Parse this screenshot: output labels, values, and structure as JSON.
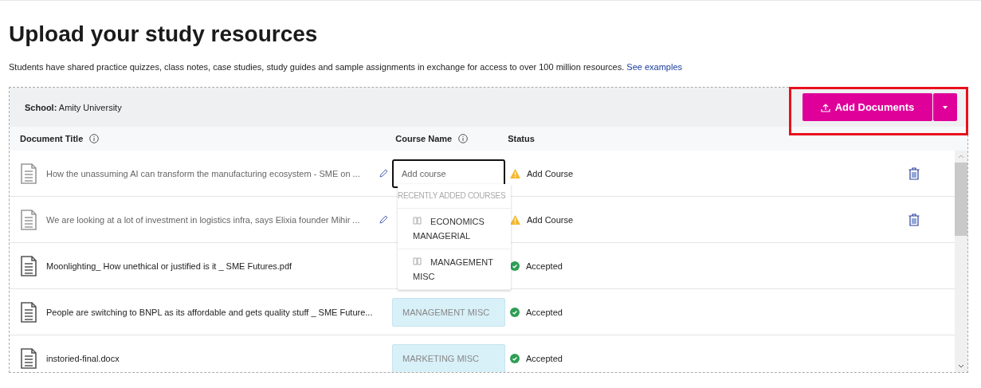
{
  "title": "Upload your study resources",
  "intro": {
    "text": "Students have shared practice quizzes, class notes, case studies, study guides and sample assignments in exchange for access to over 100 million resources.",
    "link": "See examples"
  },
  "school": {
    "label": "School:",
    "value": "Amity University"
  },
  "add_button": {
    "label": "Add Documents"
  },
  "columns": [
    "Document Title",
    "Course Name",
    "Status"
  ],
  "rows": [
    {
      "title": "How the unassuming AI can transform the manufacturing ecosystem - SME on ...",
      "pending": true,
      "course_field": {
        "placeholder": "Add course"
      },
      "status": {
        "kind": "warning",
        "label": "Add Course"
      }
    },
    {
      "title": "We are looking at a lot of investment in logistics infra, says Elixia founder Mihir ...",
      "pending": true,
      "status": {
        "kind": "warning",
        "label": "Add Course"
      }
    },
    {
      "title": "Moonlighting_ How unethical or justified is it _ SME Futures.pdf",
      "pending": false,
      "status": {
        "kind": "accepted",
        "label": "Accepted"
      }
    },
    {
      "title": "People are switching to BNPL as its affordable and gets quality stuff _ SME Future...",
      "pending": false,
      "course": "MANAGEMENT MISC",
      "status": {
        "kind": "accepted",
        "label": "Accepted"
      }
    },
    {
      "title": "instoried-final.docx",
      "pending": false,
      "course": "MARKETING MISC",
      "status": {
        "kind": "accepted",
        "label": "Accepted"
      }
    }
  ],
  "dropdown": {
    "heading": "RECENTLY ADDED COURSES",
    "items": [
      "ECONOMICS MANAGERIAL",
      "MANAGEMENT MISC"
    ]
  }
}
